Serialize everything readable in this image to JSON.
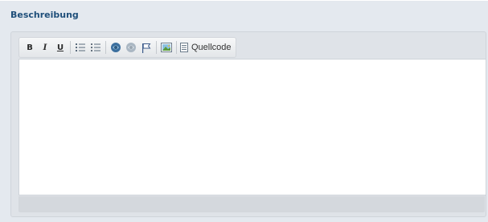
{
  "section": {
    "title": "Beschreibung"
  },
  "toolbar": {
    "bold_label": "B",
    "italic_label": "I",
    "underline_label": "U",
    "ordered_list_icon": "ordered-list-icon",
    "unordered_list_icon": "unordered-list-icon",
    "link_icon": "link-icon",
    "unlink_icon": "unlink-icon",
    "anchor_icon": "flag-icon",
    "image_icon": "image-icon",
    "source_label": "Quellcode"
  },
  "editor": {
    "content": ""
  },
  "colors": {
    "title": "#1f4f7a",
    "panel_bg": "#e4e9ef",
    "editor_bg": "#ffffff"
  }
}
